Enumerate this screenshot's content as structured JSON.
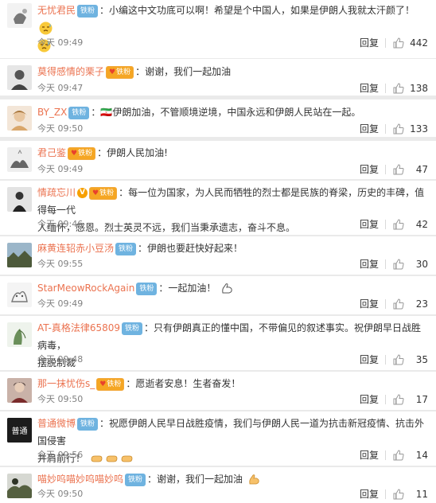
{
  "reply_label": "回复",
  "fans_label": "铁粉",
  "comments": [
    {
      "user": "无忧君民",
      "sep": "：",
      "text": "小编这中文功底可以啊！希望是个中国人，如果是伊朗人我就太汗颜了！",
      "time": "今天 09:49",
      "likes": "442"
    },
    {
      "user": "莫得感情的栗子",
      "sep": "：",
      "text": "谢谢，我们一起加油",
      "time": "今天 09:47",
      "likes": "138"
    },
    {
      "user": "BY_ZX",
      "sep": "：",
      "text": "🇮🇷伊朗加油，不管顺境逆境，中国永远和伊朗人民站在一起。",
      "time": "今天 09:50",
      "likes": "133"
    },
    {
      "user": "君己鉴",
      "sep": "：",
      "text": "伊朗人民加油!",
      "time": "今天 09:49",
      "likes": "47"
    },
    {
      "user": "情疏忘川",
      "sep": "：",
      "text": "每一位为国家，为人民而牺牲的烈士都是民族的脊梁，历史的丰碑，值得每一代",
      "text2": "人缅怀，感恩。烈士英灵不远，我们当秉承遗志，奋斗不息。",
      "time": "今天 09:46",
      "likes": "42"
    },
    {
      "user": "麻黄连轺赤小豆汤",
      "sep": "：",
      "text": "伊朗也要赶快好起来！",
      "time": "今天 09:55",
      "likes": "30"
    },
    {
      "user": "StarMeowRockAgain",
      "sep": "：",
      "text": "一起加油！",
      "time": "今天 09:49",
      "likes": "23"
    },
    {
      "user": "AT-真格法律65809",
      "sep": "：",
      "text": "只有伊朗真正的懂中国，不带偏见的叙述事实。祝伊朗早日战胜病毒，",
      "text2": "摆脱制裁",
      "time": "今天 09:48",
      "likes": "35"
    },
    {
      "user": "那一抹忧伤s_",
      "sep": "：",
      "text": "愿逝者安息！生者奋发！",
      "time": "今天 09:50",
      "likes": "17"
    },
    {
      "user": "普通微博",
      "sep": "：",
      "text": "祝愿伊朗人民早日战胜疫情，我们与伊朗人民一道为抗击新冠疫情、抗击外国侵害",
      "text2": "并肩前行！",
      "time": "今天 09:56",
      "likes": "14"
    },
    {
      "user": "喵妙呜喵妙呜喵妙呜",
      "sep": "：",
      "text": "谢谢，我们一起加油",
      "time": "今天 09:50",
      "likes": "11"
    }
  ],
  "avatar_text_pt": "普通",
  "colors": {
    "username": "#eb7350",
    "meta": "#808080",
    "background": "#eaeaea"
  }
}
